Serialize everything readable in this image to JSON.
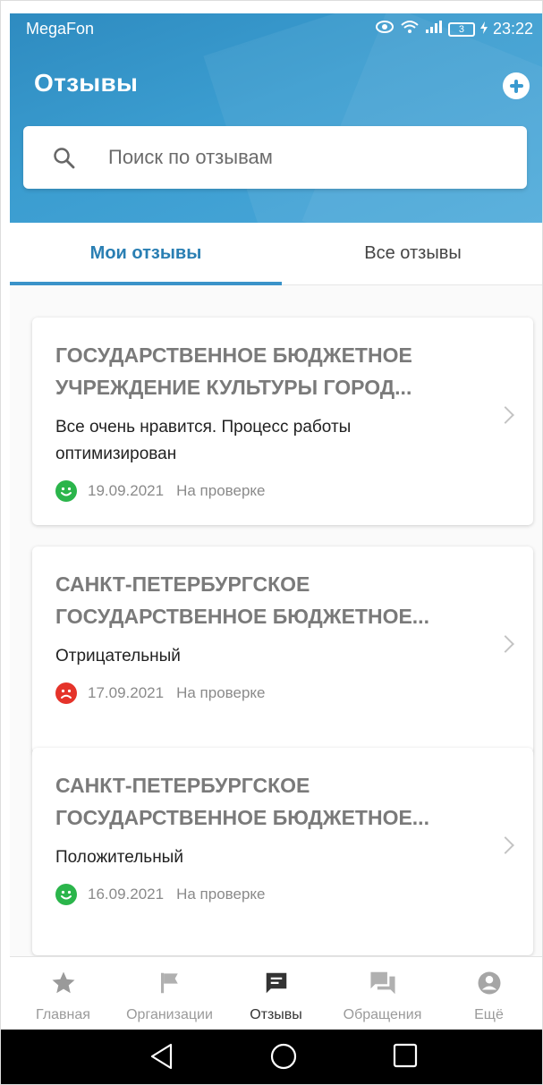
{
  "status_bar": {
    "carrier": "MegaFon",
    "battery": "3",
    "time": "23:22"
  },
  "header": {
    "title": "Отзывы",
    "add_icon": "plus-circle-icon"
  },
  "search": {
    "placeholder": "Поиск по отзывам",
    "value": ""
  },
  "tabs": [
    {
      "label": "Мои отзывы",
      "active": true
    },
    {
      "label": "Все отзывы",
      "active": false
    }
  ],
  "reviews": [
    {
      "org_line1": "ГОСУДАРСТВЕННОЕ БЮДЖЕТНОЕ",
      "org_line2": "УЧРЕЖДЕНИЕ КУЛЬТУРЫ ГОРОД...",
      "text": "Все очень нравится. Процесс работы оптимизирован",
      "mood": "positive",
      "date": "19.09.2021",
      "status": "На проверке"
    },
    {
      "org_line1": "САНКТ-ПЕТЕРБУРГСКОЕ",
      "org_line2": "ГОСУДАРСТВЕННОЕ БЮДЖЕТНОЕ...",
      "text": "Отрицательный",
      "mood": "negative",
      "date": "17.09.2021",
      "status": "На проверке"
    },
    {
      "org_line1": "САНКТ-ПЕТЕРБУРГСКОЕ",
      "org_line2": "ГОСУДАРСТВЕННОЕ БЮДЖЕТНОЕ...",
      "text": "Положительный",
      "mood": "positive",
      "date": "16.09.2021",
      "status": "На проверке"
    }
  ],
  "bottom_nav": [
    {
      "label": "Главная",
      "icon": "star-icon",
      "active": false
    },
    {
      "label": "Организации",
      "icon": "flag-icon",
      "active": false
    },
    {
      "label": "Отзывы",
      "icon": "message-icon",
      "active": true
    },
    {
      "label": "Обращения",
      "icon": "chat-icon",
      "active": false
    },
    {
      "label": "Ещё",
      "icon": "account-icon",
      "active": false
    }
  ],
  "colors": {
    "header": "#3b9dd0",
    "accent": "#2a7fb3",
    "positive": "#2bb54b",
    "negative": "#e5332a"
  }
}
